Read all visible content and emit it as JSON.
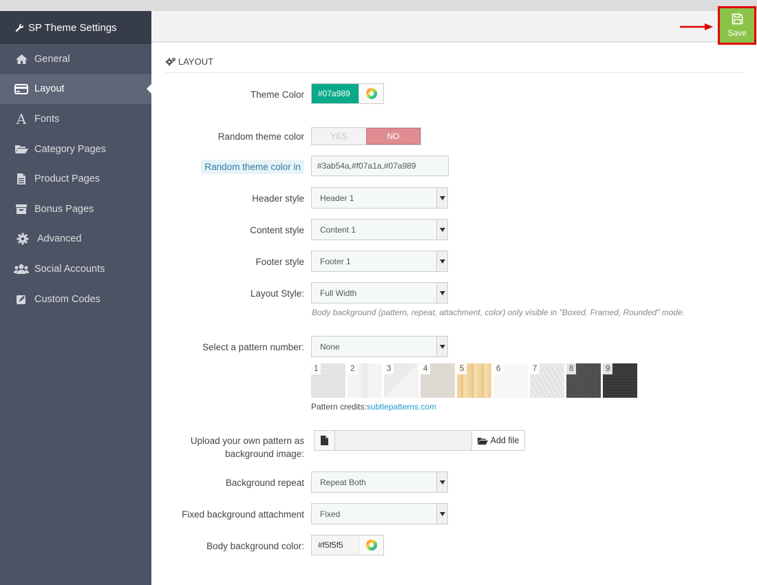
{
  "sidebar": {
    "title": "SP Theme Settings",
    "items": [
      {
        "label": "General",
        "icon": "home-icon"
      },
      {
        "label": "Layout",
        "icon": "credit-card-icon"
      },
      {
        "label": "Fonts",
        "icon": "font-icon"
      },
      {
        "label": "Category Pages",
        "icon": "folder-open-icon"
      },
      {
        "label": "Product Pages",
        "icon": "file-icon"
      },
      {
        "label": "Bonus Pages",
        "icon": "archive-icon"
      },
      {
        "label": "Advanced",
        "icon": "gear-icon"
      },
      {
        "label": "Social Accounts",
        "icon": "users-icon"
      },
      {
        "label": "Custom Codes",
        "icon": "edit-icon"
      }
    ]
  },
  "header": {
    "save_label": "Save"
  },
  "section": {
    "title": "LAYOUT"
  },
  "form": {
    "theme_color": {
      "label": "Theme Color",
      "value": "#07a989"
    },
    "random_theme": {
      "label": "Random theme color",
      "yes": "YES",
      "no": "NO"
    },
    "random_in": {
      "label": "Random theme color in",
      "value": "#3ab54a,#f07a1a,#07a989"
    },
    "header_style": {
      "label": "Header style",
      "value": "Header 1"
    },
    "content_style": {
      "label": "Content style",
      "value": "Content 1"
    },
    "footer_style": {
      "label": "Footer style",
      "value": "Footer 1"
    },
    "layout_style": {
      "label": "Layout Style:",
      "value": "Full Width",
      "hint": "Body background (pattern, repeat, attachment, color) only visible in \"Boxed, Framed, Rounded\" mode."
    },
    "pattern": {
      "label": "Select a pattern number:",
      "value": "None",
      "numbers": [
        "1",
        "2",
        "3",
        "4",
        "5",
        "6",
        "7",
        "8",
        "9"
      ],
      "credits_prefix": "Pattern credits:",
      "credits_link": "subtlepatterns.com"
    },
    "upload": {
      "label_line1": "Upload your own pattern as",
      "label_line2": "background image:",
      "button": "Add file"
    },
    "bg_repeat": {
      "label": "Background repeat",
      "value": "Repeat Both"
    },
    "fixed_attach": {
      "label": "Fixed background attachment",
      "value": "Fixed"
    },
    "body_bg": {
      "label": "Body background color:",
      "value": "#f5f5f5"
    }
  },
  "colors": {
    "theme": "#07a989",
    "save_bg": "#8bc34a",
    "sidebar_bg": "#4c5364",
    "no_bg": "#e08d92"
  }
}
